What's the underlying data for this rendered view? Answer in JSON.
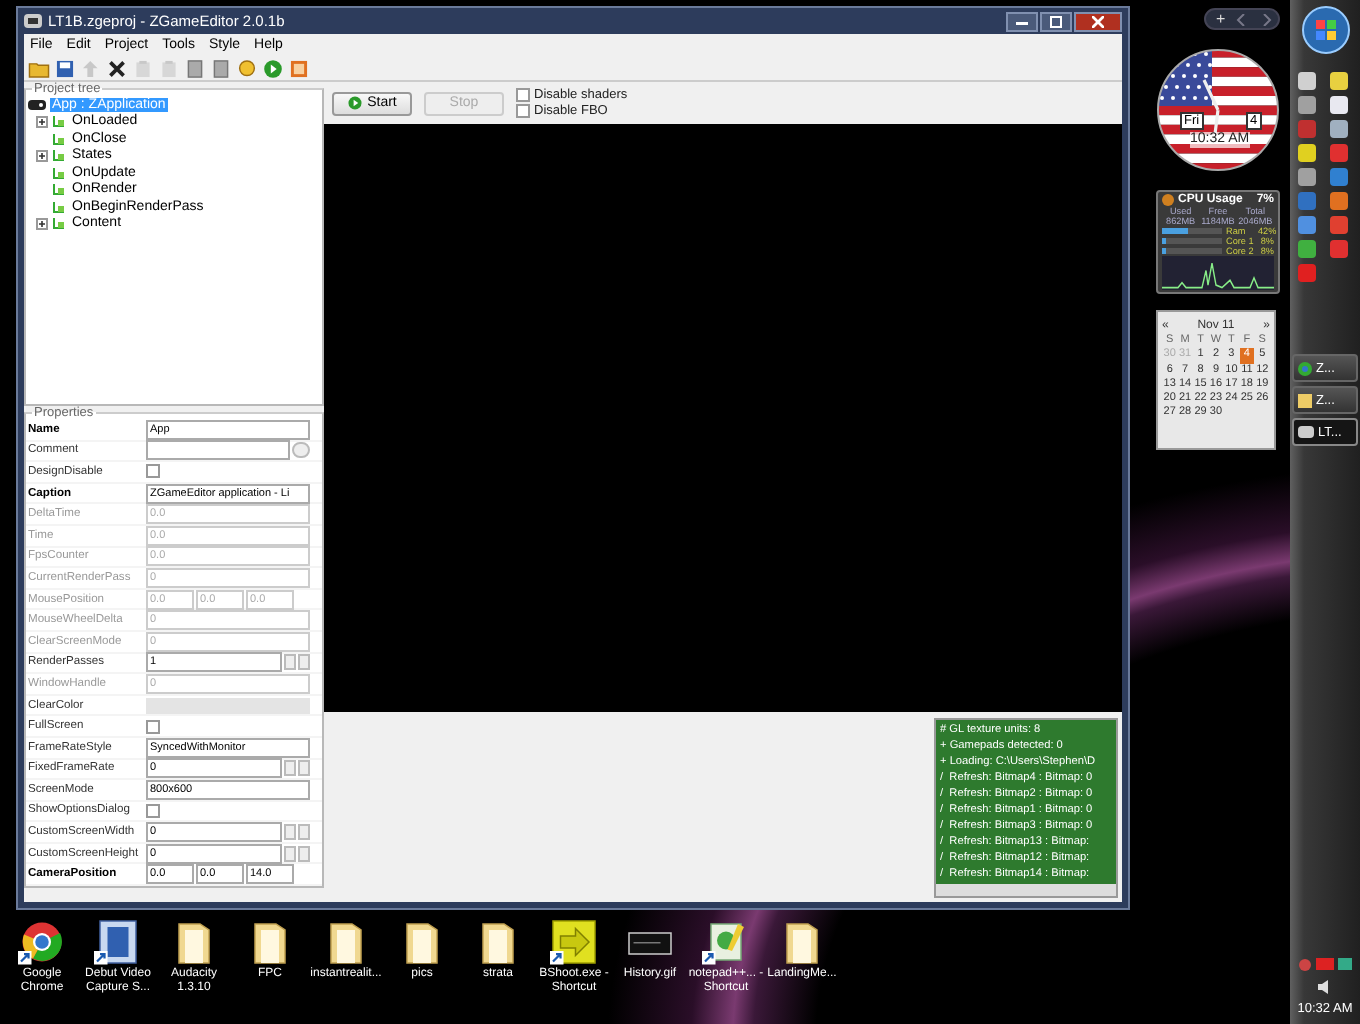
{
  "window": {
    "title": "LT1B.zgeproj - ZGameEditor 2.0.1b"
  },
  "menu": [
    "File",
    "Edit",
    "Project",
    "Tools",
    "Style",
    "Help"
  ],
  "toolbar": [
    {
      "kind": "folder",
      "disabled": false
    },
    {
      "kind": "disk",
      "disabled": false
    },
    {
      "kind": "arrow",
      "disabled": true
    },
    {
      "kind": "cross",
      "disabled": false
    },
    {
      "kind": "clipboard",
      "disabled": true
    },
    {
      "kind": "clipboard",
      "disabled": true
    },
    {
      "kind": "page",
      "disabled": false
    },
    {
      "kind": "page",
      "disabled": false
    },
    {
      "kind": "bulb",
      "disabled": false
    },
    {
      "kind": "play",
      "disabled": false
    },
    {
      "kind": "picture",
      "disabled": false
    }
  ],
  "project_tree": {
    "title": "Project tree",
    "root": {
      "label": "App : ZApplication",
      "selected": true
    },
    "items": [
      {
        "label": "OnLoaded",
        "expandable": true,
        "selected": false
      },
      {
        "label": "OnClose",
        "expandable": false,
        "selected": false
      },
      {
        "label": "States",
        "expandable": true,
        "selected": false
      },
      {
        "label": "OnUpdate",
        "expandable": false,
        "selected": false
      },
      {
        "label": "OnRender",
        "expandable": false,
        "selected": false
      },
      {
        "label": "OnBeginRenderPass",
        "expandable": false,
        "selected": false
      },
      {
        "label": "Content",
        "expandable": true,
        "selected": false
      }
    ]
  },
  "properties": {
    "title": "Properties",
    "rows": [
      {
        "name": "Name",
        "kind": "text",
        "value": "App",
        "bold": true,
        "disabled": false
      },
      {
        "name": "Comment",
        "kind": "text_button",
        "bold": false,
        "disabled": false
      },
      {
        "name": "DesignDisable",
        "kind": "check",
        "checked": false,
        "bold": false,
        "disabled": false
      },
      {
        "name": "Caption",
        "kind": "text",
        "value": "ZGameEditor application - Li",
        "bold": true,
        "disabled": false
      },
      {
        "name": "DeltaTime",
        "kind": "text",
        "value": "0.0",
        "bold": false,
        "disabled": true
      },
      {
        "name": "Time",
        "kind": "text",
        "value": "0.0",
        "bold": false,
        "disabled": true
      },
      {
        "name": "FpsCounter",
        "kind": "text",
        "value": "0.0",
        "bold": false,
        "disabled": true
      },
      {
        "name": "CurrentRenderPass",
        "kind": "text",
        "value": "0",
        "bold": false,
        "disabled": true
      },
      {
        "name": "MousePosition",
        "kind": "triple",
        "values": [
          "0.0",
          "0.0",
          "0.0"
        ],
        "bold": false,
        "disabled": true
      },
      {
        "name": "MouseWheelDelta",
        "kind": "text",
        "value": "0",
        "bold": false,
        "disabled": true
      },
      {
        "name": "ClearScreenMode",
        "kind": "text",
        "value": "0",
        "bold": false,
        "disabled": true
      },
      {
        "name": "RenderPasses",
        "kind": "spin",
        "value": "1",
        "bold": false,
        "disabled": false
      },
      {
        "name": "WindowHandle",
        "kind": "text",
        "value": "0",
        "bold": false,
        "disabled": true
      },
      {
        "name": "ClearColor",
        "kind": "color",
        "bold": false,
        "disabled": false
      },
      {
        "name": "FullScreen",
        "kind": "check",
        "checked": false,
        "bold": false,
        "disabled": false
      },
      {
        "name": "FrameRateStyle",
        "kind": "combo",
        "value": "SyncedWithMonitor",
        "bold": false,
        "disabled": false
      },
      {
        "name": "FixedFrameRate",
        "kind": "spin",
        "value": "0",
        "bold": false,
        "disabled": false
      },
      {
        "name": "ScreenMode",
        "kind": "combo",
        "value": "800x600",
        "bold": false,
        "disabled": false
      },
      {
        "name": "ShowOptionsDialog",
        "kind": "check",
        "checked": false,
        "bold": false,
        "disabled": false
      },
      {
        "name": "CustomScreenWidth",
        "kind": "spin",
        "value": "0",
        "bold": false,
        "disabled": false
      },
      {
        "name": "CustomScreenHeight",
        "kind": "spin",
        "value": "0",
        "bold": false,
        "disabled": false
      },
      {
        "name": "CameraPosition",
        "kind": "triple",
        "values": [
          "0.0",
          "0.0",
          "14.0"
        ],
        "bold": true,
        "disabled": false
      }
    ]
  },
  "preview": {
    "start": {
      "label": "Start",
      "disabled": false
    },
    "stop": {
      "label": "Stop",
      "disabled": true
    },
    "options": [
      {
        "label": "Disable shaders",
        "checked": false
      },
      {
        "label": "Disable FBO",
        "checked": false
      }
    ]
  },
  "log": [
    "# GL texture units: 8",
    "+ Gamepads detected: 0",
    "+ Loading: C:\\Users\\Stephen\\D",
    "/  Refresh: Bitmap4 : Bitmap: 0",
    "/  Refresh: Bitmap2 : Bitmap: 0",
    "/  Refresh: Bitmap1 : Bitmap: 0",
    "/  Refresh: Bitmap3 : Bitmap: 0",
    "/  Refresh: Bitmap13 : Bitmap:",
    "/  Refresh: Bitmap12 : Bitmap:",
    "/  Refresh: Bitmap14 : Bitmap:"
  ],
  "desktop_icons": [
    {
      "label": "Google Chrome",
      "kind": "browser",
      "shortcut": true
    },
    {
      "label": "Debut Video Capture S...",
      "kind": "film",
      "shortcut": true
    },
    {
      "label": "Audacity 1.3.10",
      "kind": "folder",
      "shortcut": false
    },
    {
      "label": "FPC",
      "kind": "folder",
      "shortcut": false
    },
    {
      "label": "instantrealit...",
      "kind": "folder",
      "shortcut": false
    },
    {
      "label": "pics",
      "kind": "folder",
      "shortcut": false
    },
    {
      "label": "strata",
      "kind": "folder",
      "shortcut": false
    },
    {
      "label": "BShoot.exe - Shortcut",
      "kind": "arrow",
      "shortcut": true
    },
    {
      "label": "History.gif",
      "kind": "image",
      "shortcut": false
    },
    {
      "label": "notepad++... - Shortcut",
      "kind": "notepad",
      "shortcut": true
    },
    {
      "label": "LandingMe...",
      "kind": "folder",
      "shortcut": false
    }
  ],
  "gadget_bar": {
    "add": "+"
  },
  "clock": {
    "day": "Fri",
    "date": "4",
    "time": "10:32 AM"
  },
  "cpu": {
    "title": "CPU Usage",
    "percent": "7%",
    "headers": [
      "Used",
      "Free",
      "Total"
    ],
    "memory": [
      "862MB",
      "1184MB",
      "2046MB"
    ],
    "meters": [
      {
        "label": "Ram",
        "reading": "42%",
        "level": 0.42
      },
      {
        "label": "Core 1",
        "reading": "8%",
        "level": 0.08
      },
      {
        "label": "Core 2",
        "reading": "8%",
        "level": 0.08
      }
    ]
  },
  "calendar": {
    "prev": "«",
    "month": "Nov 11",
    "next": "»",
    "weekdays": [
      "S",
      "M",
      "T",
      "W",
      "T",
      "F",
      "S"
    ],
    "days": [
      {
        "label": "30",
        "muted": true,
        "selected": false
      },
      {
        "label": "31",
        "muted": true,
        "selected": false
      },
      {
        "label": "1",
        "muted": false,
        "selected": false
      },
      {
        "label": "2",
        "muted": false,
        "selected": false
      },
      {
        "label": "3",
        "muted": false,
        "selected": false
      },
      {
        "label": "4",
        "muted": false,
        "selected": true
      },
      {
        "label": "5",
        "muted": false,
        "selected": false
      },
      {
        "label": "6",
        "muted": false,
        "selected": false
      },
      {
        "label": "7",
        "muted": false,
        "selected": false
      },
      {
        "label": "8",
        "muted": false,
        "selected": false
      },
      {
        "label": "9",
        "muted": false,
        "selected": false
      },
      {
        "label": "10",
        "muted": false,
        "selected": false
      },
      {
        "label": "11",
        "muted": false,
        "selected": false
      },
      {
        "label": "12",
        "muted": false,
        "selected": false
      },
      {
        "label": "13",
        "muted": false,
        "selected": false
      },
      {
        "label": "14",
        "muted": false,
        "selected": false
      },
      {
        "label": "15",
        "muted": false,
        "selected": false
      },
      {
        "label": "16",
        "muted": false,
        "selected": false
      },
      {
        "label": "17",
        "muted": false,
        "selected": false
      },
      {
        "label": "18",
        "muted": false,
        "selected": false
      },
      {
        "label": "19",
        "muted": false,
        "selected": false
      },
      {
        "label": "20",
        "muted": false,
        "selected": false
      },
      {
        "label": "21",
        "muted": false,
        "selected": false
      },
      {
        "label": "22",
        "muted": false,
        "selected": false
      },
      {
        "label": "23",
        "muted": false,
        "selected": false
      },
      {
        "label": "24",
        "muted": false,
        "selected": false
      },
      {
        "label": "25",
        "muted": false,
        "selected": false
      },
      {
        "label": "26",
        "muted": false,
        "selected": false
      },
      {
        "label": "27",
        "muted": false,
        "selected": false
      },
      {
        "label": "28",
        "muted": false,
        "selected": false
      },
      {
        "label": "29",
        "muted": false,
        "selected": false
      },
      {
        "label": "30",
        "muted": false,
        "selected": false
      }
    ]
  },
  "taskbar": {
    "quick_launch": [
      {
        "color": "#d0d0d0"
      },
      {
        "color": "#e8d040"
      },
      {
        "color": "#a0a0a0"
      },
      {
        "color": "#e8e8f0"
      },
      {
        "color": "#c03030"
      },
      {
        "color": "#a0b0c0"
      },
      {
        "color": "#e0d020"
      },
      {
        "color": "#e03030"
      },
      {
        "color": "#a0a0a0"
      },
      {
        "color": "#3080d0"
      },
      {
        "color": "#3070c0"
      },
      {
        "color": "#e07020"
      },
      {
        "color": "#5090e0"
      },
      {
        "color": "#e04030"
      },
      {
        "color": "#40b040"
      },
      {
        "color": "#e03030"
      },
      {
        "color": "#e02020"
      }
    ],
    "tasks": [
      {
        "label": "Z...",
        "kind": "browser",
        "selected": false
      },
      {
        "label": "Z...",
        "kind": "folder",
        "selected": false
      },
      {
        "label": "LT...",
        "kind": "app",
        "selected": true
      }
    ],
    "time": "10:32 AM"
  }
}
